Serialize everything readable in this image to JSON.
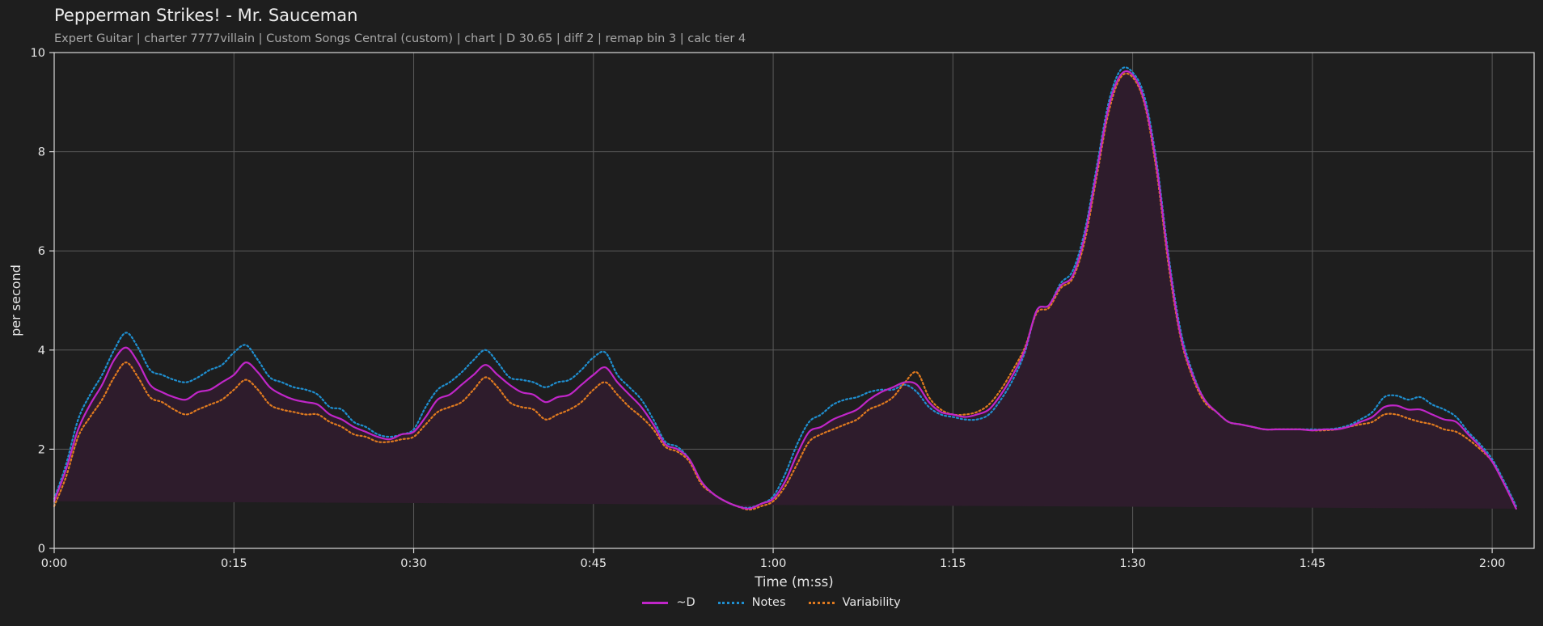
{
  "title": "Pepperman Strikes! - Mr. Sauceman",
  "subtitle": "Expert Guitar  |  charter 7777villain  |  Custom Songs Central (custom)  |  chart  |  D 30.65  |  diff 2  |  remap bin 3  |  calc tier 4",
  "colors": {
    "background": "#1e1e1e",
    "grid": "#5a5a5a",
    "axis_text": "#e6e6e6",
    "d_line": "#c026c8",
    "d_fill": "#2e1c2c",
    "notes": "#1f8fd0",
    "variability": "#e07a1f"
  },
  "chart_data": {
    "type": "line",
    "title": "Pepperman Strikes! - Mr. Sauceman",
    "xlabel": "Time (m:ss)",
    "ylabel": "per second",
    "xlim": [
      0,
      123.5
    ],
    "ylim": [
      0,
      10
    ],
    "x_ticks": [
      0,
      15,
      30,
      45,
      60,
      75,
      90,
      105,
      120
    ],
    "x_tick_labels": [
      "0:00",
      "0:15",
      "0:30",
      "0:45",
      "1:00",
      "1:15",
      "1:30",
      "1:45",
      "2:00"
    ],
    "y_ticks": [
      0,
      2,
      4,
      6,
      8,
      10
    ],
    "y_tick_labels": [
      "0",
      "2",
      "4",
      "6",
      "8",
      "10"
    ],
    "grid": true,
    "legend_position": "bottom-center",
    "x": [
      0,
      1,
      2,
      3,
      4,
      5,
      6,
      7,
      8,
      9,
      10,
      11,
      12,
      13,
      14,
      15,
      16,
      17,
      18,
      19,
      20,
      21,
      22,
      23,
      24,
      25,
      26,
      27,
      28,
      29,
      30,
      31,
      32,
      33,
      34,
      35,
      36,
      37,
      38,
      39,
      40,
      41,
      42,
      43,
      44,
      45,
      46,
      47,
      48,
      49,
      50,
      51,
      52,
      53,
      54,
      55,
      56,
      57,
      58,
      59,
      60,
      61,
      62,
      63,
      64,
      65,
      66,
      67,
      68,
      69,
      70,
      71,
      72,
      73,
      74,
      75,
      76,
      77,
      78,
      79,
      80,
      81,
      82,
      83,
      84,
      85,
      86,
      87,
      88,
      89,
      90,
      91,
      92,
      93,
      94,
      95,
      96,
      97,
      98,
      99,
      100,
      101,
      102,
      103,
      104,
      105,
      106,
      107,
      108,
      109,
      110,
      111,
      112,
      113,
      114,
      115,
      116,
      117,
      118,
      119,
      120,
      121,
      122,
      123,
      123.5
    ],
    "series": [
      {
        "name": "~D",
        "style": "solid-filled",
        "values": [
          0.95,
          1.6,
          2.4,
          2.9,
          3.3,
          3.8,
          4.05,
          3.75,
          3.3,
          3.15,
          3.05,
          3.0,
          3.15,
          3.2,
          3.35,
          3.5,
          3.75,
          3.55,
          3.25,
          3.1,
          3.0,
          2.95,
          2.9,
          2.7,
          2.6,
          2.45,
          2.35,
          2.25,
          2.2,
          2.3,
          2.35,
          2.65,
          3.0,
          3.1,
          3.3,
          3.5,
          3.7,
          3.5,
          3.3,
          3.15,
          3.1,
          2.95,
          3.05,
          3.1,
          3.3,
          3.5,
          3.65,
          3.35,
          3.1,
          2.85,
          2.5,
          2.1,
          2.0,
          1.8,
          1.35,
          1.1,
          0.95,
          0.85,
          0.8,
          0.9,
          1.0,
          1.35,
          1.9,
          2.35,
          2.45,
          2.6,
          2.7,
          2.8,
          3.0,
          3.15,
          3.25,
          3.35,
          3.3,
          2.95,
          2.75,
          2.7,
          2.65,
          2.7,
          2.8,
          3.1,
          3.5,
          4.0,
          4.8,
          4.9,
          5.3,
          5.5,
          6.3,
          7.6,
          8.9,
          9.55,
          9.55,
          9.0,
          7.7,
          5.8,
          4.3,
          3.5,
          3.0,
          2.75,
          2.55,
          2.5,
          2.45,
          2.4,
          2.4,
          2.4,
          2.4,
          2.38,
          2.4,
          2.4,
          2.45,
          2.55,
          2.65,
          2.85,
          2.88,
          2.8,
          2.8,
          2.7,
          2.6,
          2.55,
          2.3,
          2.05,
          1.75,
          1.3,
          0.8,
          0.25
        ]
      },
      {
        "name": "Notes",
        "style": "dotted",
        "values": [
          1.0,
          1.7,
          2.6,
          3.1,
          3.5,
          4.0,
          4.35,
          4.05,
          3.6,
          3.5,
          3.4,
          3.35,
          3.45,
          3.6,
          3.7,
          3.95,
          4.1,
          3.8,
          3.45,
          3.35,
          3.25,
          3.2,
          3.1,
          2.85,
          2.8,
          2.55,
          2.45,
          2.3,
          2.25,
          2.3,
          2.4,
          2.85,
          3.2,
          3.35,
          3.55,
          3.8,
          4.0,
          3.75,
          3.45,
          3.4,
          3.35,
          3.25,
          3.35,
          3.4,
          3.6,
          3.85,
          3.95,
          3.5,
          3.25,
          3.0,
          2.6,
          2.15,
          2.05,
          1.8,
          1.35,
          1.1,
          0.95,
          0.85,
          0.82,
          0.9,
          1.05,
          1.5,
          2.1,
          2.55,
          2.7,
          2.9,
          3.0,
          3.05,
          3.15,
          3.2,
          3.2,
          3.3,
          3.15,
          2.85,
          2.7,
          2.65,
          2.6,
          2.6,
          2.7,
          3.0,
          3.4,
          3.95,
          4.8,
          4.9,
          5.35,
          5.6,
          6.4,
          7.7,
          9.0,
          9.65,
          9.6,
          9.1,
          7.8,
          5.9,
          4.4,
          3.55,
          3.0,
          2.75,
          2.55,
          2.5,
          2.45,
          2.4,
          2.4,
          2.4,
          2.4,
          2.4,
          2.4,
          2.42,
          2.48,
          2.6,
          2.75,
          3.05,
          3.08,
          3.0,
          3.05,
          2.9,
          2.8,
          2.65,
          2.35,
          2.1,
          1.8,
          1.35,
          0.85,
          0.3
        ]
      },
      {
        "name": "Variability",
        "style": "dotted",
        "values": [
          0.85,
          1.45,
          2.25,
          2.65,
          3.0,
          3.45,
          3.75,
          3.45,
          3.05,
          2.95,
          2.8,
          2.7,
          2.8,
          2.9,
          3.0,
          3.2,
          3.4,
          3.2,
          2.9,
          2.8,
          2.75,
          2.7,
          2.7,
          2.55,
          2.45,
          2.3,
          2.25,
          2.15,
          2.15,
          2.2,
          2.25,
          2.5,
          2.75,
          2.85,
          2.95,
          3.2,
          3.45,
          3.25,
          2.95,
          2.85,
          2.8,
          2.6,
          2.7,
          2.8,
          2.95,
          3.2,
          3.35,
          3.1,
          2.85,
          2.65,
          2.4,
          2.05,
          1.95,
          1.75,
          1.3,
          1.1,
          0.95,
          0.85,
          0.78,
          0.85,
          0.95,
          1.25,
          1.7,
          2.15,
          2.3,
          2.4,
          2.5,
          2.6,
          2.8,
          2.9,
          3.05,
          3.35,
          3.55,
          3.05,
          2.8,
          2.7,
          2.7,
          2.75,
          2.9,
          3.2,
          3.6,
          4.05,
          4.75,
          4.85,
          5.25,
          5.45,
          6.2,
          7.5,
          8.8,
          9.5,
          9.5,
          8.95,
          7.6,
          5.7,
          4.25,
          3.45,
          2.95,
          2.75,
          2.55,
          2.5,
          2.45,
          2.4,
          2.4,
          2.4,
          2.4,
          2.38,
          2.38,
          2.4,
          2.45,
          2.5,
          2.55,
          2.7,
          2.7,
          2.62,
          2.55,
          2.5,
          2.4,
          2.35,
          2.2,
          2.0,
          1.75,
          1.3,
          0.8,
          0.25
        ]
      }
    ]
  }
}
